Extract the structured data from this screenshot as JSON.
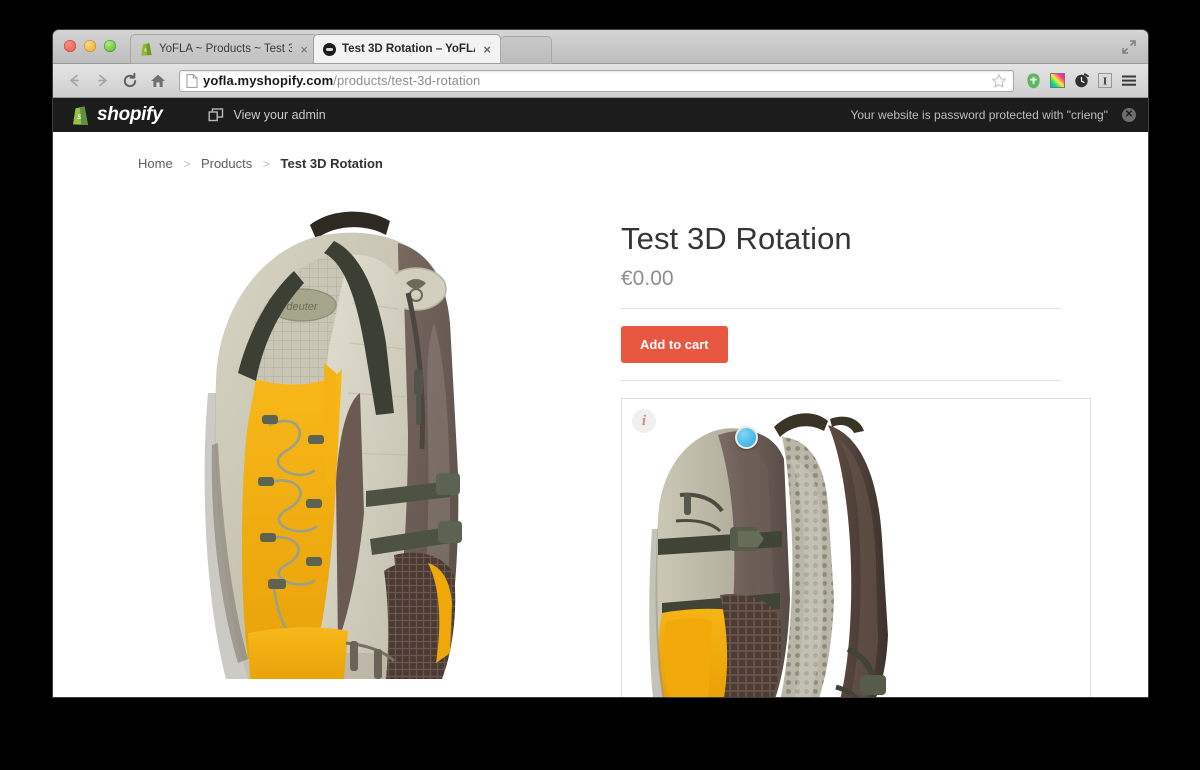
{
  "browser": {
    "traffic_lights": [
      "close",
      "minimize",
      "zoom"
    ],
    "fullscreen_label": "Enter Full Screen",
    "tabs": [
      {
        "title": "YoFLA ~ Products ~ Test 3",
        "favicon": "shopify-favicon",
        "active": false,
        "close_label": "×"
      },
      {
        "title": "Test 3D Rotation – YoFLA",
        "favicon": "yofla-favicon",
        "active": true,
        "close_label": "×"
      }
    ],
    "new_tab_label": "",
    "nav": {
      "back": "←",
      "forward": "→",
      "reload": "C",
      "home": "home-icon"
    },
    "url": {
      "domain": "yofla.myshopify.com",
      "path": "/products/test-3d-rotation",
      "page_icon": "page-icon",
      "bookmark_icon": "star-icon"
    },
    "extensions": [
      {
        "name": "evernote-icon",
        "color": "#5cb85c"
      },
      {
        "name": "colorpicker-icon",
        "color": "#ff00ff"
      },
      {
        "name": "clock-icon",
        "color": "#2f2f2f"
      },
      {
        "name": "italic-icon",
        "label": "I",
        "color": "#333333"
      },
      {
        "name": "menu-icon",
        "color": "#333333"
      }
    ]
  },
  "admin_bar": {
    "brand": "shopify",
    "brand_icon": "shopify-bag-icon",
    "view_admin_label": "View your admin",
    "view_admin_icon": "windows-icon",
    "password_notice": "Your website is password protected with \"crieng\"",
    "close_icon": "close-circle-icon",
    "background": "#1c1c1c"
  },
  "breadcrumb": {
    "items": [
      {
        "label": "Home",
        "current": false
      },
      {
        "label": "Products",
        "current": false
      },
      {
        "label": "Test 3D Rotation",
        "current": true
      }
    ],
    "separator": ">"
  },
  "product": {
    "title": "Test 3D Rotation",
    "price": "€0.00",
    "add_to_cart_label": "Add to cart",
    "accent_color": "#e8573f",
    "main_image_alt": "Backpack front three-quarter view",
    "viewer": {
      "info_icon": "info-icon",
      "info_glyph": "i",
      "hotspot_name": "rotation-hotspot",
      "hotspot_color": "#27a8db",
      "image_alt": "Backpack side view 3D rotation frame"
    }
  }
}
